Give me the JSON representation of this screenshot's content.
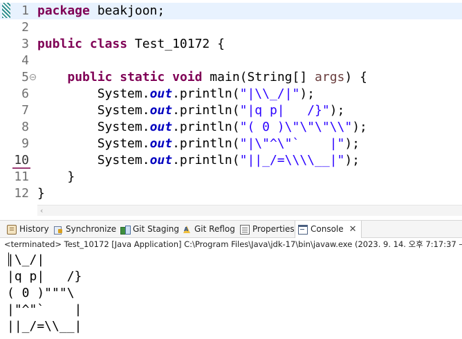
{
  "editor": {
    "lines": [
      {
        "num": "1",
        "tokens": [
          {
            "t": "package",
            "c": "kw"
          },
          {
            "t": " beakjoon;",
            "c": ""
          }
        ]
      },
      {
        "num": "2",
        "tokens": []
      },
      {
        "num": "3",
        "tokens": [
          {
            "t": "public",
            "c": "kw"
          },
          {
            "t": " ",
            "c": ""
          },
          {
            "t": "class",
            "c": "kw"
          },
          {
            "t": " Test_10172 {",
            "c": ""
          }
        ]
      },
      {
        "num": "4",
        "tokens": []
      },
      {
        "num": "5",
        "tokens": [
          {
            "t": "    ",
            "c": ""
          },
          {
            "t": "public",
            "c": "kw"
          },
          {
            "t": " ",
            "c": ""
          },
          {
            "t": "static",
            "c": "kw"
          },
          {
            "t": " ",
            "c": ""
          },
          {
            "t": "void",
            "c": "kw"
          },
          {
            "t": " main(String[] ",
            "c": ""
          },
          {
            "t": "args",
            "c": "par"
          },
          {
            "t": ") {",
            "c": ""
          }
        ]
      },
      {
        "num": "6",
        "tokens": [
          {
            "t": "        System.",
            "c": ""
          },
          {
            "t": "out",
            "c": "fld"
          },
          {
            "t": ".println(",
            "c": ""
          },
          {
            "t": "\"|\\\\_/|\"",
            "c": "str"
          },
          {
            "t": ");",
            "c": ""
          }
        ]
      },
      {
        "num": "7",
        "tokens": [
          {
            "t": "        System.",
            "c": ""
          },
          {
            "t": "out",
            "c": "fld"
          },
          {
            "t": ".println(",
            "c": ""
          },
          {
            "t": "\"|q p|   /}\"",
            "c": "str"
          },
          {
            "t": ");",
            "c": ""
          }
        ]
      },
      {
        "num": "8",
        "tokens": [
          {
            "t": "        System.",
            "c": ""
          },
          {
            "t": "out",
            "c": "fld"
          },
          {
            "t": ".println(",
            "c": ""
          },
          {
            "t": "\"( 0 )\\\"\\\"\\\"\\\\\"",
            "c": "str"
          },
          {
            "t": ");",
            "c": ""
          }
        ]
      },
      {
        "num": "9",
        "tokens": [
          {
            "t": "        System.",
            "c": ""
          },
          {
            "t": "out",
            "c": "fld"
          },
          {
            "t": ".println(",
            "c": ""
          },
          {
            "t": "\"|\\\"^\\\"`    |\"",
            "c": "str"
          },
          {
            "t": ");",
            "c": ""
          }
        ]
      },
      {
        "num": "10",
        "tokens": [
          {
            "t": "        System.",
            "c": ""
          },
          {
            "t": "out",
            "c": "fld"
          },
          {
            "t": ".println(",
            "c": ""
          },
          {
            "t": "\"||_/=\\\\\\\\__|\"",
            "c": "str"
          },
          {
            "t": ");",
            "c": ""
          }
        ]
      },
      {
        "num": "11",
        "tokens": [
          {
            "t": "    }",
            "c": ""
          }
        ]
      },
      {
        "num": "12",
        "tokens": [
          {
            "t": "}",
            "c": ""
          }
        ]
      }
    ],
    "current_line": "1",
    "selected_line": "10"
  },
  "views": {
    "tabs": [
      {
        "label": "History",
        "icon": "history-icon"
      },
      {
        "label": "Synchronize",
        "icon": "synchronize-icon"
      },
      {
        "label": "Git Staging",
        "icon": "git-staging-icon"
      },
      {
        "label": "Git Reflog",
        "icon": "git-reflog-icon"
      },
      {
        "label": "Properties",
        "icon": "properties-icon"
      },
      {
        "label": "Console",
        "icon": "console-icon",
        "active": true
      }
    ],
    "close_glyph": "✕"
  },
  "console": {
    "status": "<terminated> Test_10172 [Java Application] C:\\Program Files\\Java\\jdk-17\\bin\\javaw.exe  (2023. 9. 14. 오후 7:17:37 –",
    "output": [
      "|\\_/|",
      "|q p|   /}",
      "( 0 )\"\"\"\\",
      "|\"^\"`    |",
      "||_/=\\\\__|"
    ]
  },
  "colors": {
    "keyword": "#7f0055",
    "field": "#0000c0",
    "string": "#2a00ff",
    "parameter": "#6a3e3e",
    "current_line_bg": "#e8f2fe"
  }
}
